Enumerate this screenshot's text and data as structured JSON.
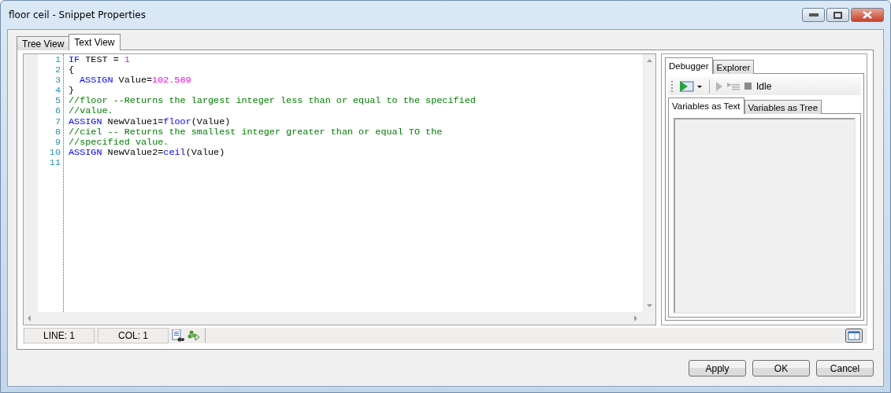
{
  "window": {
    "title": "floor ceil - Snippet Properties"
  },
  "tabs": [
    {
      "label": "Tree View",
      "selected": false
    },
    {
      "label": "Text View",
      "selected": true
    }
  ],
  "code_lines": [
    {
      "number": "1",
      "tokens": [
        {
          "kind": "keyword",
          "text": "IF"
        },
        {
          "kind": "plain",
          "text": " TEST = "
        },
        {
          "kind": "number",
          "text": "1"
        }
      ]
    },
    {
      "number": "2",
      "tokens": [
        {
          "kind": "plain",
          "text": "{"
        }
      ]
    },
    {
      "number": "3",
      "indented": true,
      "tokens": [
        {
          "kind": "keyword",
          "text": "ASSIGN"
        },
        {
          "kind": "plain",
          "text": " Value="
        },
        {
          "kind": "number",
          "text": "102.589"
        }
      ]
    },
    {
      "number": "4",
      "tokens": [
        {
          "kind": "plain",
          "text": "}"
        }
      ]
    },
    {
      "number": "5",
      "tokens": [
        {
          "kind": "comment",
          "text": "//floor --Returns the largest integer less than or equal to the specified"
        }
      ]
    },
    {
      "number": "6",
      "tokens": [
        {
          "kind": "comment",
          "text": "//value."
        }
      ]
    },
    {
      "number": "7",
      "tokens": [
        {
          "kind": "keyword",
          "text": "ASSIGN"
        },
        {
          "kind": "plain",
          "text": " NewValue1="
        },
        {
          "kind": "keyword",
          "text": "floor"
        },
        {
          "kind": "plain",
          "text": "(Value)"
        }
      ]
    },
    {
      "number": "8",
      "tokens": [
        {
          "kind": "comment",
          "text": "//ciel -- Returns the smallest integer greater than or equal TO the"
        }
      ]
    },
    {
      "number": "9",
      "tokens": [
        {
          "kind": "comment",
          "text": "//specified value."
        }
      ]
    },
    {
      "number": "10",
      "tokens": [
        {
          "kind": "keyword",
          "text": "ASSIGN"
        },
        {
          "kind": "plain",
          "text": " NewValue2="
        },
        {
          "kind": "keyword",
          "text": "ceil"
        },
        {
          "kind": "plain",
          "text": "(Value)"
        }
      ]
    },
    {
      "number": "11"
    }
  ],
  "status_bar": {
    "line": "LINE: 1",
    "col": "COL: 1"
  },
  "side_tabs": [
    {
      "label": "Debugger",
      "selected": true
    },
    {
      "label": "Explorer",
      "selected": false
    }
  ],
  "debugger": {
    "state": "Idle"
  },
  "variable_tabs": [
    {
      "label": "Variables as Text",
      "selected": true
    },
    {
      "label": "Variables as Tree",
      "selected": false
    }
  ],
  "buttons": [
    "Apply",
    "OK",
    "Cancel"
  ]
}
